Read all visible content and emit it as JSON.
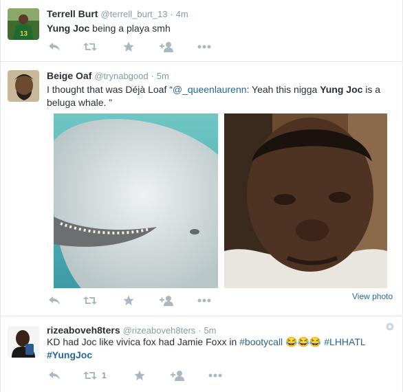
{
  "tweets": [
    {
      "name": "Terrell Burt",
      "handle": "@terrell_burt_13",
      "time": "4m",
      "text_bold": "Yung Joc",
      "text_rest": " being a playa smh"
    },
    {
      "name": "Beige Oaf",
      "handle": "@trynabgood",
      "time": "5m",
      "text_1": "I thought that was Déjà Loaf “",
      "mention": "@_queenlaurenn",
      "text_2": ": Yeah this nigga ",
      "text_bold": "Yung Joc",
      "text_3": " is a beluga whale. ”",
      "view_photo": "View photo"
    },
    {
      "name": "rizeaboveh8ters",
      "handle": "@rizeaboveh8ters",
      "time": "5m",
      "text_1": "KD had Joc like vivica fox had Jamie Foxx  in ",
      "hashtag_1": "#bootycall",
      "emoji": "😂😂😂",
      "hashtag_2": "#LHHATL",
      "hashtag_3": "#YungJoc",
      "retweet_count": "1"
    }
  ],
  "separator": "·",
  "colors": {
    "link": "#2a6496",
    "meta": "#8899a6",
    "action": "#aab8c2",
    "divider": "#e1e8ed"
  },
  "icons": [
    "reply-icon",
    "retweet-icon",
    "favorite-icon",
    "follow-icon",
    "more-icon",
    "gear-icon"
  ]
}
